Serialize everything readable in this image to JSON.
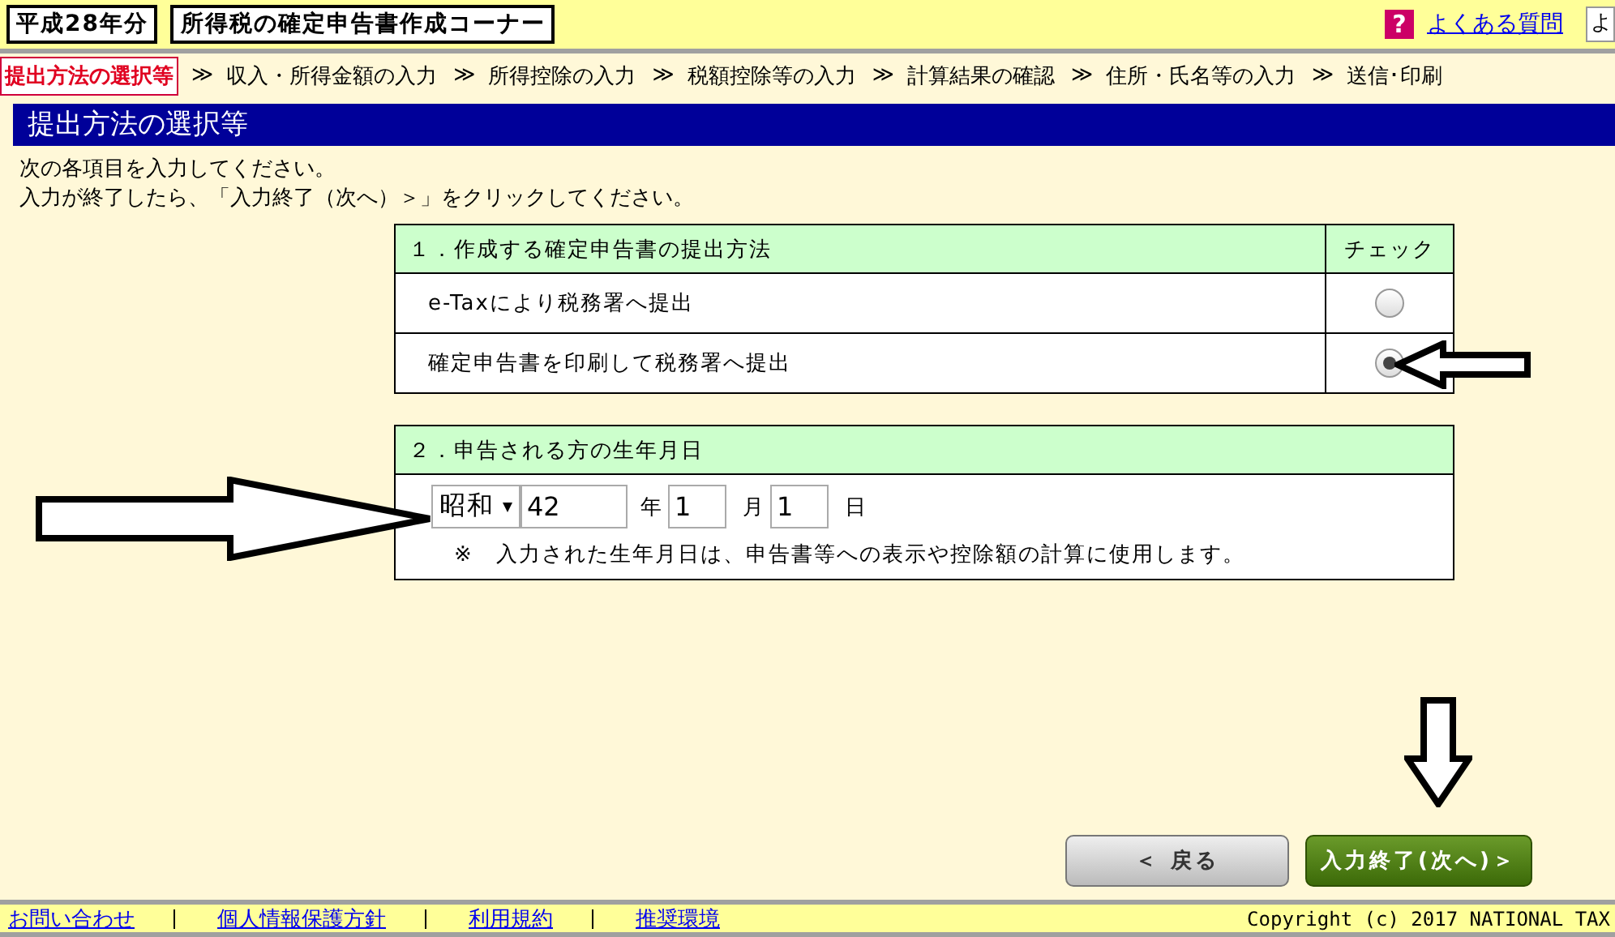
{
  "header": {
    "year_badge": "平成28年分",
    "title": "所得税の確定申告書作成コーナー",
    "help_icon": "?",
    "faq_link": "よくある質問",
    "search_value": "よ"
  },
  "steps": [
    {
      "label": "提出方法の選択等",
      "selected": true
    },
    {
      "prefix": "≫",
      "label": "収入・所得金額の入力",
      "selected": false
    },
    {
      "prefix": "≫",
      "label": "所得控除の入力",
      "selected": false
    },
    {
      "prefix": "≫",
      "label": "税額控除等の入力",
      "selected": false
    },
    {
      "prefix": "≫",
      "label": "計算結果の確認",
      "selected": false
    },
    {
      "prefix": "≫",
      "label": "住所・氏名等の入力",
      "selected": false
    },
    {
      "prefix": "≫",
      "label": "送信･印刷",
      "selected": false
    }
  ],
  "page_title": "提出方法の選択等",
  "instructions": [
    "次の各項目を入力してください。",
    "入力が終了したら、「入力終了（次へ）＞」をクリックしてください。"
  ],
  "method_table": {
    "heading": "１．作成する確定申告書の提出方法",
    "check_heading": "チェック",
    "options": [
      {
        "label": "e-Taxにより税務署へ提出",
        "selected": false
      },
      {
        "label": "確定申告書を印刷して税務署へ提出",
        "selected": true
      }
    ]
  },
  "birth_section": {
    "heading": "２．申告される方の生年月日",
    "era": "昭和",
    "year": "42",
    "year_unit": "年",
    "month": "1",
    "month_unit": "月",
    "day": "1",
    "day_unit": "日",
    "note": "※　入力された生年月日は、申告書等への表示や控除額の計算に使用します。"
  },
  "buttons": [
    {
      "label": "＜ 戻る",
      "kind": "back"
    },
    {
      "label": "入力終了(次へ)＞",
      "kind": "next"
    }
  ],
  "footer": {
    "links": [
      "お問い合わせ",
      "個人情報保護方針",
      "利用規約",
      "推奨環境"
    ],
    "copyright": "Copyright (c) 2017 NATIONAL TAX"
  }
}
